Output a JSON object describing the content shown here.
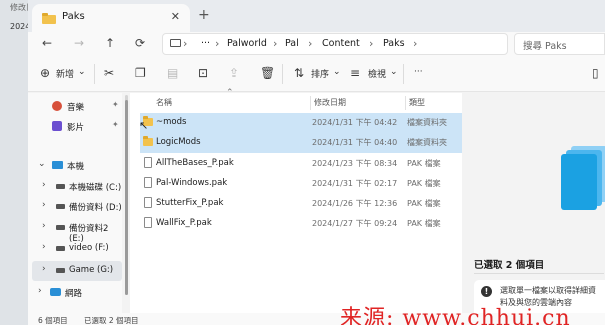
{
  "desktop": {
    "top_text": "修改日",
    "side_text": "2024"
  },
  "window": {
    "tab_title": "Paks",
    "new_tab": "+",
    "close_tab": "✕"
  },
  "address": {
    "back": "←",
    "forward": "→",
    "up": "↑",
    "refresh": "⟳",
    "more": "···",
    "crumbs": [
      "Palworld",
      "Pal",
      "Content",
      "Paks"
    ],
    "search_placeholder": "搜尋 Paks"
  },
  "toolbar": {
    "new_label": "新增",
    "sort_label": "排序",
    "view_label": "檢視",
    "more": "···"
  },
  "sidebar": {
    "pinned": [
      {
        "label": "音樂"
      },
      {
        "label": "影片"
      }
    ],
    "this_pc": "本機",
    "drives": [
      {
        "label": "本機磁碟 (C:)"
      },
      {
        "label": "備份資料 (D:)"
      },
      {
        "label": "備份資料2 (E:)"
      },
      {
        "label": "video (F:)"
      },
      {
        "label": "Game (G:)"
      }
    ],
    "network": "網路"
  },
  "file_list": {
    "columns": {
      "name": "名稱",
      "date": "修改日期",
      "type": "類型"
    },
    "rows": [
      {
        "name": "~mods",
        "date": "2024/1/31 下午 04:42",
        "type": "檔案資料夾",
        "kind": "folder",
        "selected": true
      },
      {
        "name": "LogicMods",
        "date": "2024/1/31 下午 04:40",
        "type": "檔案資料夾",
        "kind": "folder",
        "selected": true
      },
      {
        "name": "AllTheBases_P.pak",
        "date": "2024/1/23 下午 08:34",
        "type": "PAK 檔案",
        "kind": "file",
        "selected": false
      },
      {
        "name": "Pal-Windows.pak",
        "date": "2024/1/31 下午 02:17",
        "type": "PAK 檔案",
        "kind": "file",
        "selected": false
      },
      {
        "name": "StutterFix_P.pak",
        "date": "2024/1/26 下午 12:36",
        "type": "PAK 檔案",
        "kind": "file",
        "selected": false
      },
      {
        "name": "WallFix_P.pak",
        "date": "2024/1/27 下午 09:24",
        "type": "PAK 檔案",
        "kind": "file",
        "selected": false
      }
    ]
  },
  "details": {
    "title": "已選取 2 個項目",
    "info_line1": "選取單一檔案以取得詳細資",
    "info_line2": "料及與您的雲端內容"
  },
  "status": {
    "count": "6 個項目",
    "selected": "已選取 2 個項目"
  },
  "watermark": "来源:  www.chhui.cn",
  "colors": {
    "selection": "#cce4f7",
    "folder": "#f2c24d",
    "accent_icon": "#1ba1e2",
    "watermark": "#e02424"
  }
}
